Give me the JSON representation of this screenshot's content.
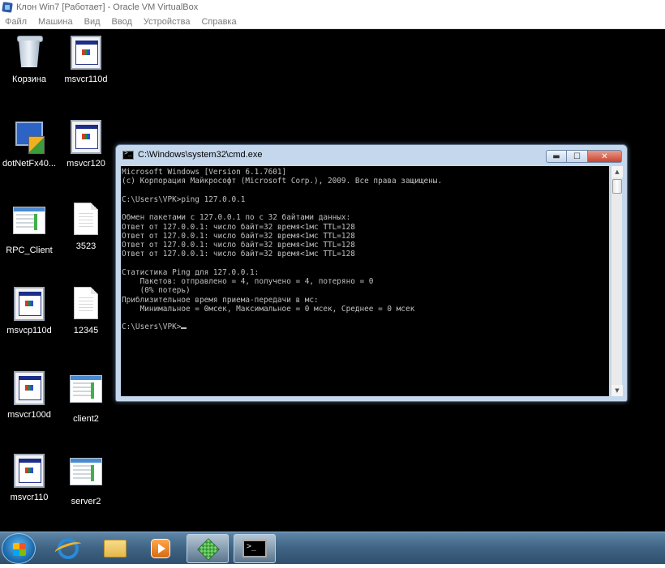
{
  "host": {
    "title": "Клон Win7 [Работает] - Oracle VM VirtualBox",
    "menu": [
      "Файл",
      "Машина",
      "Вид",
      "Ввод",
      "Устройства",
      "Справка"
    ]
  },
  "desktop": {
    "icons": [
      {
        "label": "Корзина",
        "icon": "recycle-bin-icon"
      },
      {
        "label": "msvcr110d",
        "icon": "app-window-icon"
      },
      {
        "label": "dotNetFx40...",
        "icon": "dotnet-installer-icon"
      },
      {
        "label": "msvcr120",
        "icon": "app-window-icon"
      },
      {
        "label": "RPC_Client",
        "icon": "exe-window-icon"
      },
      {
        "label": "3523",
        "icon": "document-icon"
      },
      {
        "label": "msvcp110d",
        "icon": "app-window-icon"
      },
      {
        "label": "12345",
        "icon": "document-icon"
      },
      {
        "label": "msvcr100d",
        "icon": "app-window-icon"
      },
      {
        "label": "client2",
        "icon": "exe-window-icon"
      },
      {
        "label": "msvcr110",
        "icon": "app-window-icon"
      },
      {
        "label": "server2",
        "icon": "exe-window-icon"
      }
    ]
  },
  "cmd": {
    "title": "C:\\Windows\\system32\\cmd.exe",
    "lines": [
      "Microsoft Windows [Version 6.1.7601]",
      "(c) Корпорация Майкрософт (Microsoft Corp.), 2009. Все права защищены.",
      "",
      "C:\\Users\\VPK>ping 127.0.0.1",
      "",
      "Обмен пакетами с 127.0.0.1 по с 32 байтами данных:",
      "Ответ от 127.0.0.1: число байт=32 время<1мс TTL=128",
      "Ответ от 127.0.0.1: число байт=32 время<1мс TTL=128",
      "Ответ от 127.0.0.1: число байт=32 время<1мс TTL=128",
      "Ответ от 127.0.0.1: число байт=32 время<1мс TTL=128",
      "",
      "Статистика Ping для 127.0.0.1:",
      "    Пакетов: отправлено = 4, получено = 4, потеряно = 0",
      "    (0% потерь)",
      "Приблизительное время приема-передачи в мс:",
      "    Минимальное = 0мсек, Максимальное = 0 мсек, Среднее = 0 мсек",
      "",
      "C:\\Users\\VPK>"
    ],
    "controls": {
      "minimize": "▬",
      "maximize": "☐",
      "close": "✕"
    },
    "scroll": {
      "up": "▲",
      "down": "▼"
    }
  },
  "taskbar": {
    "items": [
      {
        "icon": "internet-explorer-icon",
        "active": false
      },
      {
        "icon": "file-explorer-icon",
        "active": false
      },
      {
        "icon": "media-player-icon",
        "active": false
      },
      {
        "icon": "setup-icon",
        "active": true
      },
      {
        "icon": "command-prompt-icon",
        "active": true
      }
    ]
  }
}
